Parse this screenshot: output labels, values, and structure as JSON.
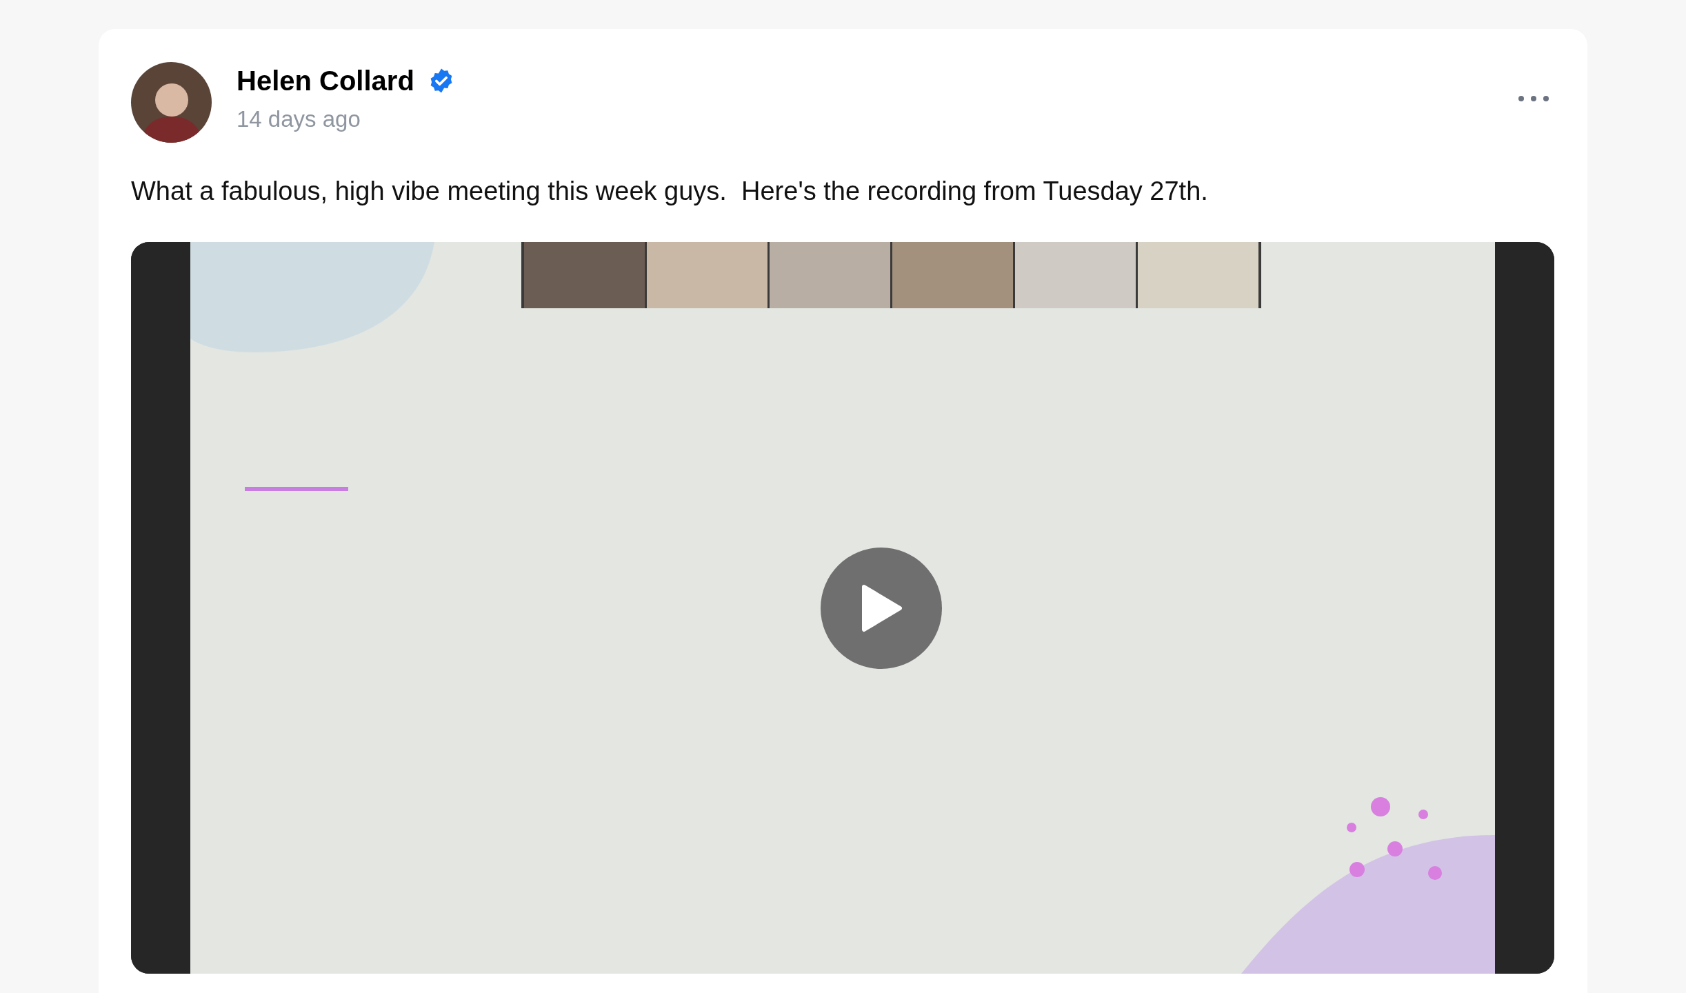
{
  "post": {
    "author": "Helen Collard",
    "verified": true,
    "time": "14 days ago",
    "text": "What a fabulous, high vibe meeting this week guys.  Here's the recording from Tuesday 27th."
  }
}
